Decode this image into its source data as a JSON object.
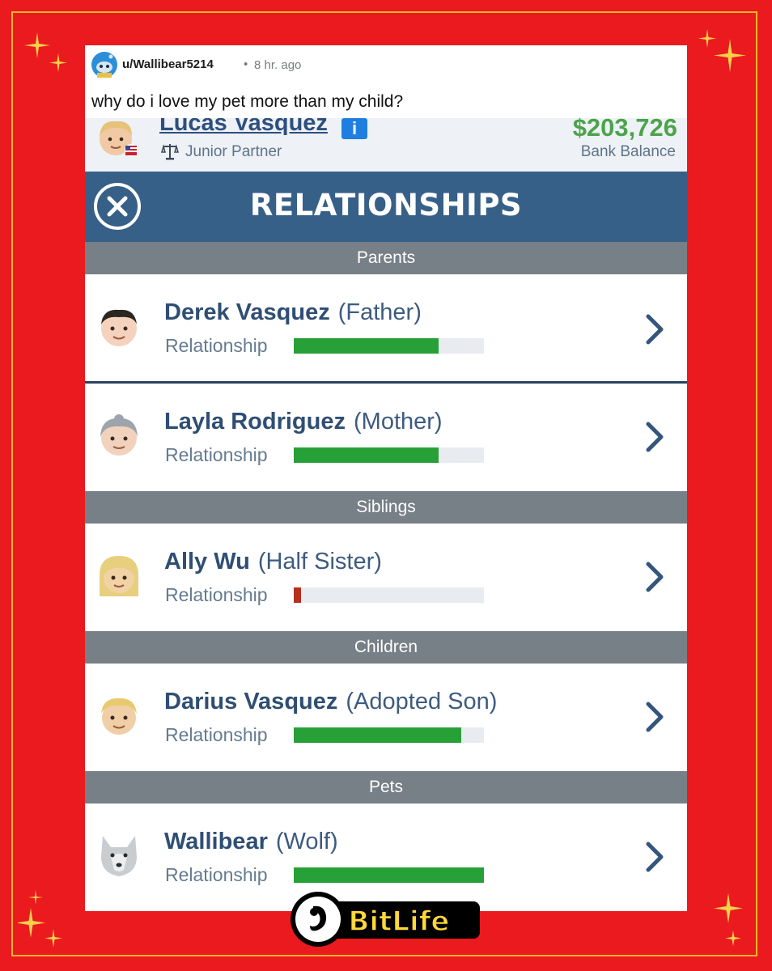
{
  "post": {
    "username": "u/Wallibear5214",
    "separator": "•",
    "time": "8 hr. ago",
    "title": "why do i love my pet more than my child?"
  },
  "game": {
    "character_name": "Lucas Vasquez",
    "info_badge": "i",
    "job": "Junior Partner",
    "balance": "$203,726",
    "balance_label": "Bank Balance"
  },
  "relationships_screen": {
    "title": "RELATIONSHIPS",
    "sections": [
      {
        "heading": "Parents",
        "people": [
          {
            "name": "Derek Vasquez",
            "role": "(Father)",
            "relationship_label": "Relationship",
            "relationship_level": 0.76,
            "bar_color": "#27a137",
            "avatar_icon": "dark-haired-man-avatar-icon"
          },
          {
            "name": "Layla Rodriguez",
            "role": "(Mother)",
            "relationship_label": "Relationship",
            "relationship_level": 0.76,
            "bar_color": "#27a137",
            "avatar_icon": "grey-haired-woman-avatar-icon"
          }
        ]
      },
      {
        "heading": "Siblings",
        "people": [
          {
            "name": "Ally Wu",
            "role": "(Half Sister)",
            "relationship_label": "Relationship",
            "relationship_level": 0.04,
            "bar_color": "#b6301e",
            "avatar_icon": "blonde-woman-avatar-icon"
          }
        ]
      },
      {
        "heading": "Children",
        "people": [
          {
            "name": "Darius Vasquez",
            "role": "(Adopted Son)",
            "relationship_label": "Relationship",
            "relationship_level": 0.88,
            "bar_color": "#27a137",
            "avatar_icon": "blonde-boy-avatar-icon"
          }
        ]
      },
      {
        "heading": "Pets",
        "people": [
          {
            "name": "Wallibear",
            "role": "(Wolf)",
            "relationship_label": "Relationship",
            "relationship_level": 1.0,
            "bar_color": "#27a137",
            "avatar_icon": "wolf-avatar-icon"
          }
        ]
      }
    ]
  },
  "branding": {
    "logo_text": "BitLife"
  },
  "colors": {
    "frame_red": "#ea1a1f",
    "frame_gold": "#f7b52c",
    "header_blue": "#376088",
    "section_grey": "#777f87",
    "balance_green": "#4ca44a"
  }
}
